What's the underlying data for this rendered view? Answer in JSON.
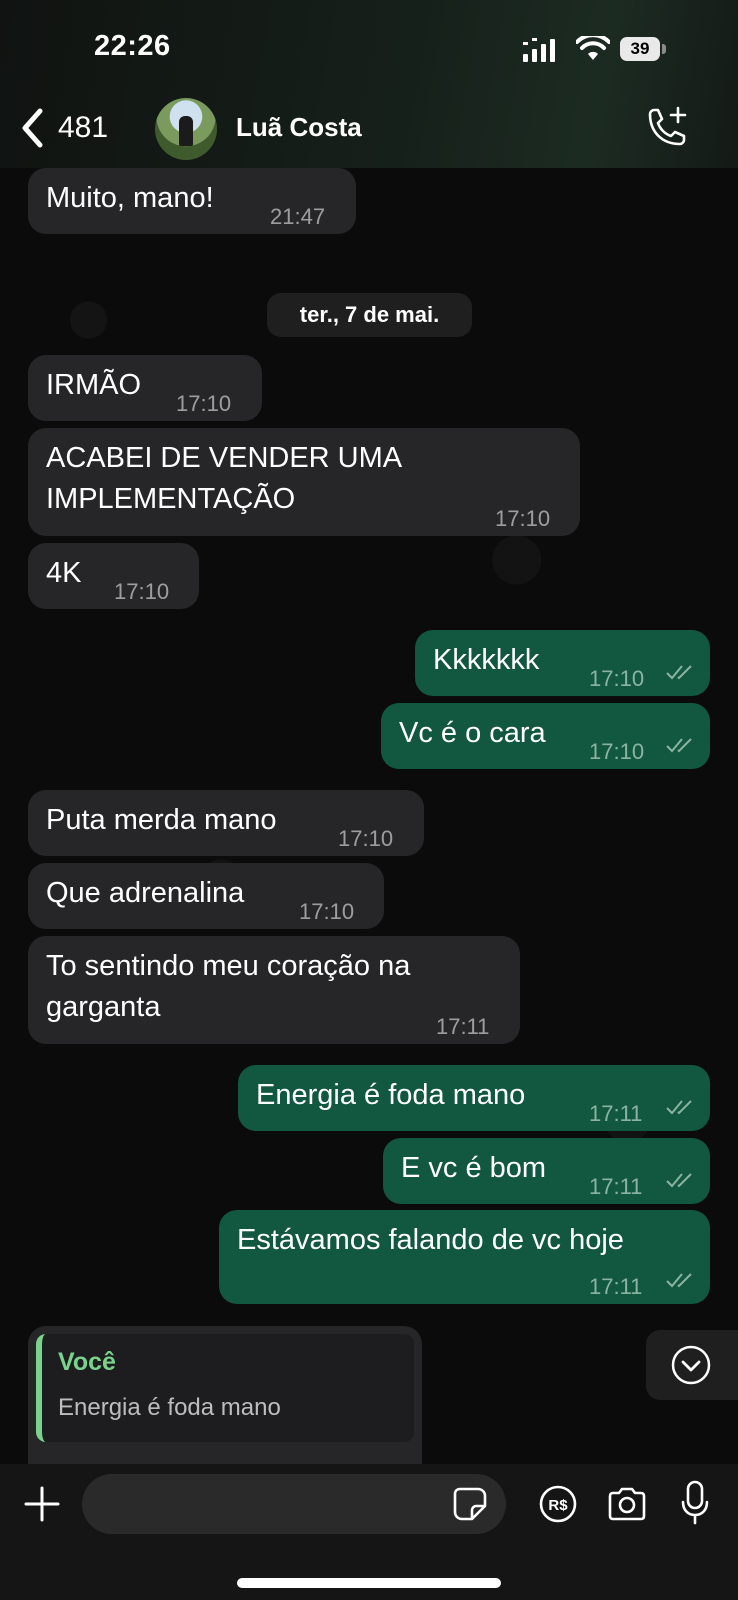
{
  "status_bar": {
    "time": "22:26",
    "battery": "39"
  },
  "header": {
    "back_count": "481",
    "contact_name": "Luã Costa"
  },
  "date_separator": "ter., 7 de mai.",
  "messages": [
    {
      "text": "Muito, mano!",
      "time": "21:47"
    },
    {
      "text": "IRMÃO",
      "time": "17:10"
    },
    {
      "text": "ACABEI DE VENDER UMA\nIMPLEMENTAÇÃO",
      "time": "17:10"
    },
    {
      "text": "4K",
      "time": "17:10"
    },
    {
      "text": "Kkkkkkk",
      "time": "17:10"
    },
    {
      "text": "Vc é o cara",
      "time": "17:10"
    },
    {
      "text": "Puta merda mano",
      "time": "17:10"
    },
    {
      "text": "Que adrenalina",
      "time": "17:10"
    },
    {
      "text": "To sentindo meu coração na\ngarganta",
      "time": "17:11"
    },
    {
      "text": "Energia é foda mano",
      "time": "17:11"
    },
    {
      "text": "E vc é bom",
      "time": "17:11"
    },
    {
      "text": "Estávamos falando de vc hoje",
      "time": "17:11"
    }
  ],
  "reply_preview": {
    "author": "Você",
    "text": "Energia é foda mano"
  },
  "composer": {
    "value": ""
  },
  "colors": {
    "incoming": "#262628",
    "outgoing": "#12573f",
    "reply_accent": "#7ad38c"
  }
}
